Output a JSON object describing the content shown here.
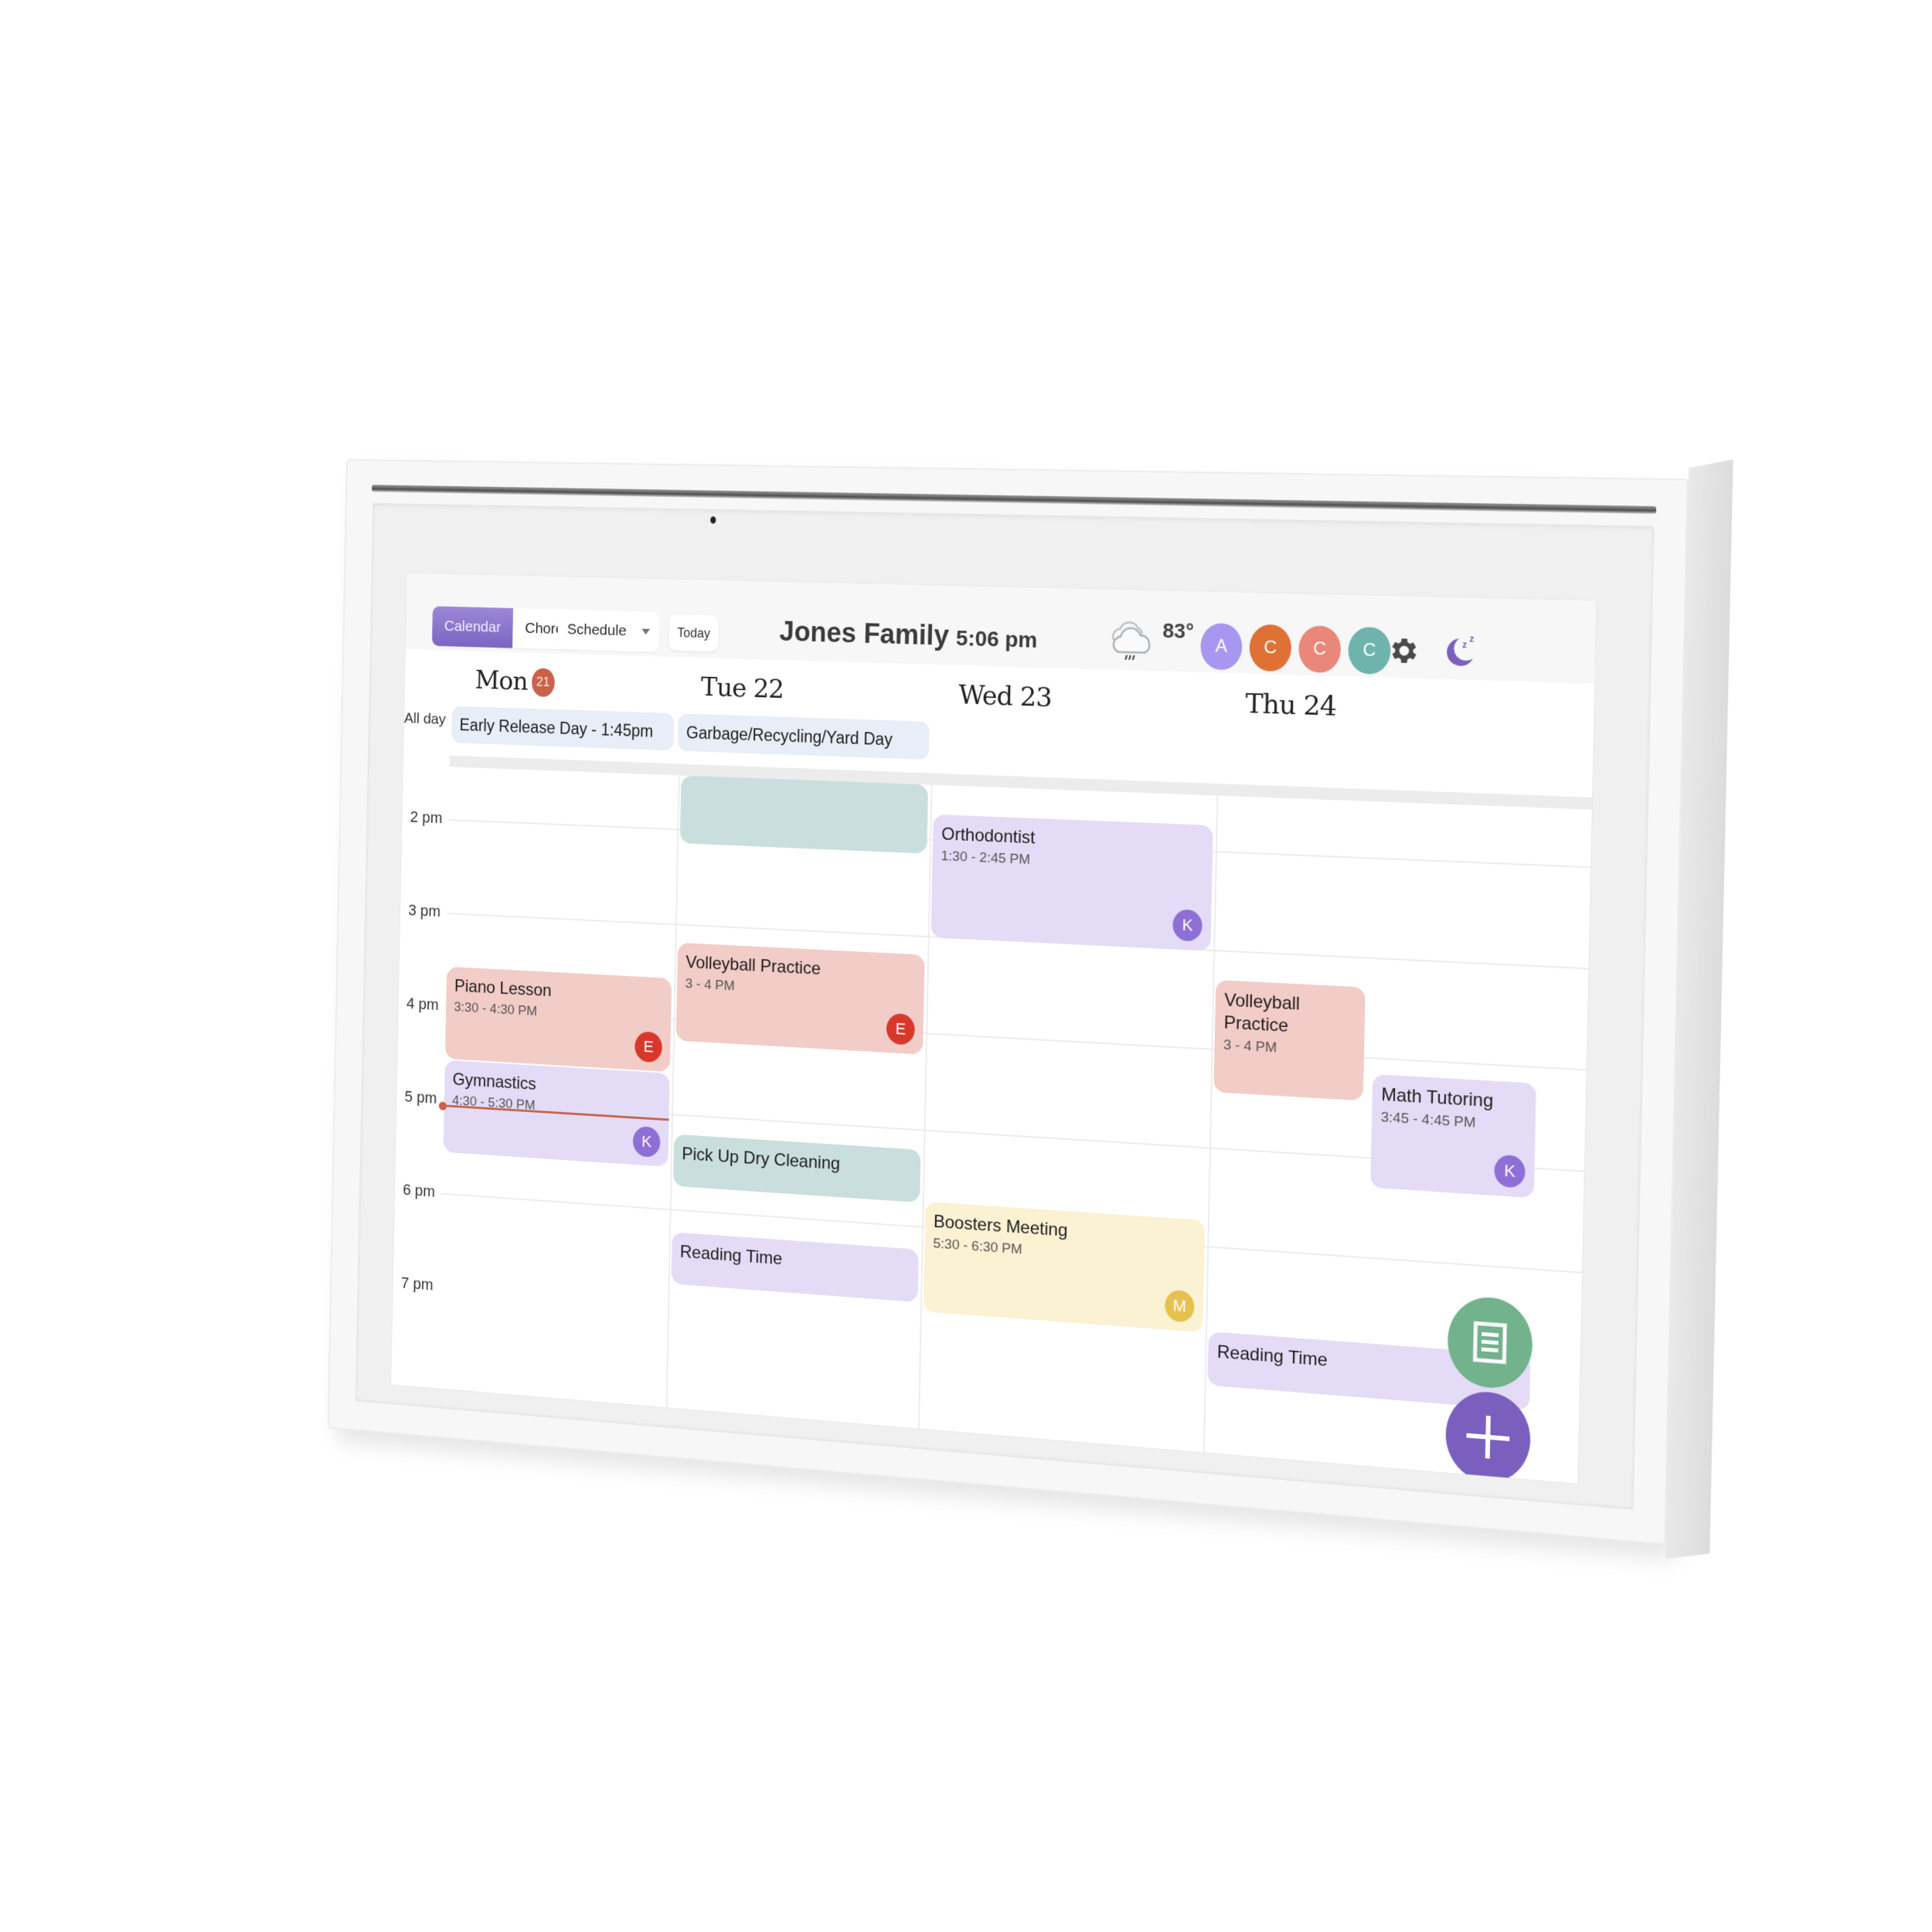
{
  "header": {
    "tabs": [
      {
        "label": "Calendar",
        "active": true
      },
      {
        "label": "Chores",
        "active": false
      }
    ],
    "view_select": {
      "value": "Schedule",
      "icon": "caret-down-icon"
    },
    "today_label": "Today",
    "family_name": "Jones Family",
    "clock": "5:06 pm",
    "weather": {
      "icon": "rain-cloud-icon",
      "temperature": "83°"
    },
    "profiles": [
      {
        "initial": "A",
        "color": "#a797f0"
      },
      {
        "initial": "C",
        "color": "#e07135"
      },
      {
        "initial": "C",
        "color": "#e9887a"
      },
      {
        "initial": "C",
        "color": "#6fb3ad"
      }
    ],
    "settings_icon": "gear-icon",
    "sleep_icon": "moon-sleep-icon"
  },
  "days": [
    {
      "label": "Mon",
      "date_badge": "21",
      "is_today": true
    },
    {
      "label": "Tue 22"
    },
    {
      "label": "Wed 23"
    },
    {
      "label": "Thu 24"
    }
  ],
  "all_day": {
    "label": "All day",
    "events": [
      {
        "day": 0,
        "title": "Early Release Day - 1:45pm"
      },
      {
        "day": 1,
        "title": "Garbage/Recycling/Yard Day"
      }
    ]
  },
  "hours": [
    "2 pm",
    "3 pm",
    "4 pm",
    "5 pm",
    "6 pm",
    "7 pm"
  ],
  "current_time": "5:06 pm",
  "events": [
    {
      "id": "tue-untitled",
      "day": 1,
      "title": "",
      "time": "",
      "color": "#c9dedd",
      "avatar": null
    },
    {
      "id": "orthodontist",
      "day": 2,
      "title": "Orthodontist",
      "time": "1:30 - 2:45 PM",
      "color": "#e4dcf6",
      "avatar": {
        "initial": "K",
        "color": "#8e6fd6"
      }
    },
    {
      "id": "volleyball-tue",
      "day": 1,
      "title": "Volleyball Practice",
      "time": "3 - 4 PM",
      "color": "#f2ccc7",
      "avatar": {
        "initial": "E",
        "color": "#d7382a"
      }
    },
    {
      "id": "piano",
      "day": 0,
      "title": "Piano Lesson",
      "time": "3:30 - 4:30 PM",
      "color": "#f2ccc7",
      "avatar": {
        "initial": "E",
        "color": "#d7382a"
      }
    },
    {
      "id": "volleyball-thu",
      "day": 3,
      "title": "Volleyball Practice",
      "time": "3 - 4 PM",
      "color": "#f2ccc7",
      "avatar": null
    },
    {
      "id": "math",
      "day": 3,
      "title": "Math Tutoring",
      "time": "3:45 - 4:45 PM",
      "color": "#e4dcf6",
      "avatar": {
        "initial": "K",
        "color": "#8e6fd6"
      }
    },
    {
      "id": "gymnastics",
      "day": 0,
      "title": "Gymnastics",
      "time": "4:30 - 5:30 PM",
      "color": "#e4dcf6",
      "avatar": {
        "initial": "K",
        "color": "#8e6fd6"
      }
    },
    {
      "id": "dry-cleaning",
      "day": 1,
      "title": "Pick Up Dry Cleaning",
      "time": "",
      "color": "#c9dedd",
      "avatar": null
    },
    {
      "id": "boosters",
      "day": 2,
      "title": "Boosters Meeting",
      "time": "5:30 - 6:30 PM",
      "color": "#fbf1d3",
      "avatar": {
        "initial": "M",
        "color": "#e6c14f"
      }
    },
    {
      "id": "reading-tue",
      "day": 1,
      "title": "Reading Time",
      "time": "",
      "color": "#e4dcf6",
      "avatar": null
    },
    {
      "id": "reading-thu",
      "day": 3,
      "title": "Reading Time",
      "time": "",
      "color": "#e4dcf6",
      "avatar": null
    }
  ],
  "fabs": {
    "notes_icon": "notes-icon",
    "add_icon": "plus-icon"
  },
  "colors": {
    "accent": "#7b5fbf",
    "today": "#c8624a",
    "now_line": "#c8624a"
  }
}
